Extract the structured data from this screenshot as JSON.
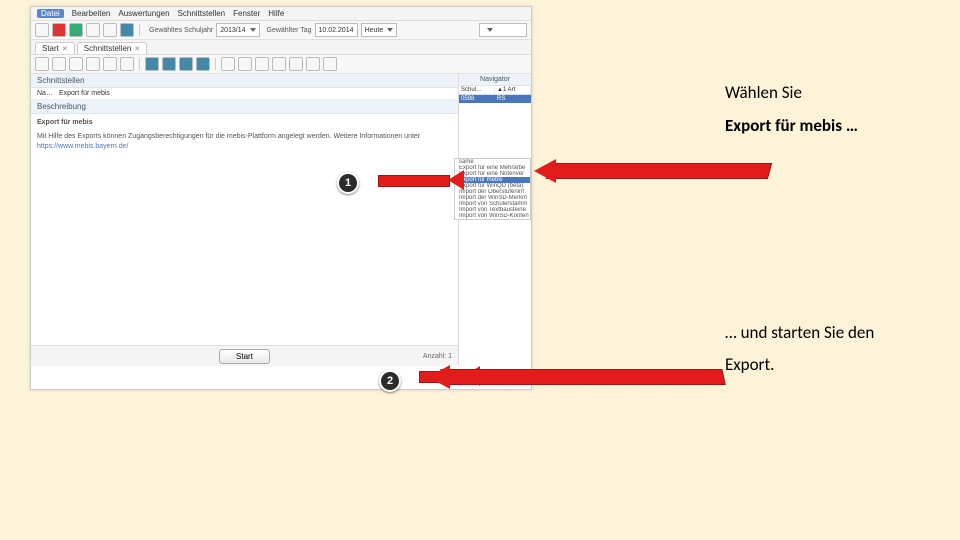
{
  "menu": [
    "Datei",
    "Bearbeiten",
    "Auswertungen",
    "Schnittstellen",
    "Fenster",
    "Hilfe"
  ],
  "toolbar2": {
    "schuljahr_lbl": "Gewähltes Schuljahr",
    "schuljahr_val": "2013/14",
    "tag_lbl": "Gewählter Tag",
    "tag_val": "10.02.2014",
    "heute": "Heute"
  },
  "tabs": {
    "t1": "Start",
    "t2": "Schnittstellen"
  },
  "left": {
    "hdr": "Schnittstellen",
    "col1": "Na…",
    "col2": "Export für mebis",
    "desc_hdr": "Beschreibung",
    "desc_title": "Export für mebis",
    "desc_body": "Mit Hilfe des Exports können Zugangsberechtigungen für die mebis-Plattform angelegt werden. Weitere Informationen unter",
    "desc_link": "https://www.mebis.bayern.de/"
  },
  "start": "Start",
  "anzahl": "Anzahl: 1",
  "nav": {
    "hdr": "Navigator",
    "c1": "Schul…",
    "c2": "▲1 Art",
    "r1": "0598",
    "r2": "RS"
  },
  "names": {
    "pre": "same",
    "items": [
      "Export für eine Mehrarbe",
      "Export für eine Notenver",
      "Export für mebis",
      "Export für WinQD (beta)",
      "Import der Oberstufeninf",
      "Import der WinSD-Merkm",
      "Import von Schülerstamm",
      "Import von Textbausteine",
      "Import von WinSD-Konten"
    ],
    "sel_index": 2
  },
  "ann": {
    "l1": "Wählen Sie",
    "l2": "Export für mebis …",
    "l3": "… und starten Sie den",
    "l4": "Export."
  },
  "badge1": "1",
  "badge2": "2"
}
